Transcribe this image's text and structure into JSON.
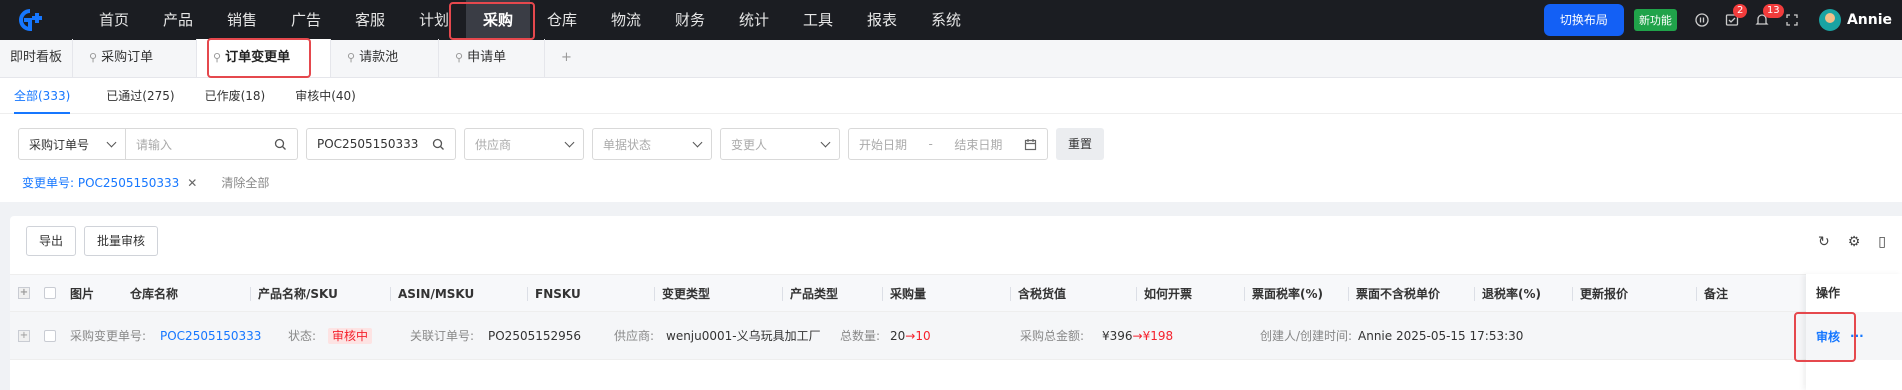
{
  "nav": {
    "logo": "G",
    "items": [
      "首页",
      "产品",
      "销售",
      "广告",
      "客服",
      "计划",
      "采购",
      "仓库",
      "物流",
      "财务",
      "统计",
      "工具",
      "报表",
      "系统"
    ],
    "active_index": 6,
    "switch_layout": "切换布局",
    "new_feature": "新功能",
    "task_badge": "2",
    "notice_badge": "13",
    "user": "Annie"
  },
  "page_tabs": [
    {
      "label": "即时看板",
      "pinned": false
    },
    {
      "label": "采购订单",
      "pinned": true
    },
    {
      "label": "订单变更单",
      "pinned": true,
      "active": true
    },
    {
      "label": "请款池",
      "pinned": true
    },
    {
      "label": "申请单",
      "pinned": true
    },
    {
      "label": "+",
      "pinned": false
    }
  ],
  "status_tabs": [
    "全部(333)",
    "已通过(275)",
    "已作废(18)",
    "审核中(40)"
  ],
  "filters": {
    "field_select": "采购订单号",
    "field_input_placeholder": "请输入",
    "search_value": "POC2505150333",
    "supplier_placeholder": "供应商",
    "doc_status_placeholder": "单据状态",
    "changer_placeholder": "变更人",
    "start_date_placeholder": "开始日期",
    "date_sep": "-",
    "end_date_placeholder": "结束日期",
    "reset": "重置"
  },
  "active_filter": {
    "label": "变更单号: POC2505150333",
    "clear_all": "清除全部"
  },
  "toolbar": {
    "export": "导出",
    "batch_review": "批量审核"
  },
  "table": {
    "columns": [
      "图片",
      "仓库名称",
      "产品名称/SKU",
      "ASIN/MSKU",
      "FNSKU",
      "变更类型",
      "产品类型",
      "采购量",
      "含税货值",
      "如何开票",
      "票面税率(%)",
      "票面不含税单价",
      "退税率(%)",
      "更新报价",
      "备注",
      "操作"
    ],
    "row": {
      "change_no_label": "采购变更单号:",
      "change_no": "POC2505150333",
      "status_label": "状态:",
      "status": "审核中",
      "order_no_label": "关联订单号:",
      "order_no": "PO2505152956",
      "supplier_label": "供应商:",
      "supplier": "wenju0001-义乌玩具加工厂",
      "qty_label": "总数量:",
      "qty_old": "20",
      "qty_arrow": "→",
      "qty_new": "10",
      "amount_label": "采购总金额:",
      "amount_old": "¥396",
      "amount_arrow": "→",
      "amount_new": "¥198",
      "creator_label": "创建人/创建时间:",
      "creator": "Annie 2025-05-15 17:53:30",
      "action_review": "审核",
      "action_more": "···"
    }
  },
  "colors": {
    "accent": "#1677ff",
    "highlight_box": "#e5484d",
    "topbar": "#1b1d22"
  }
}
